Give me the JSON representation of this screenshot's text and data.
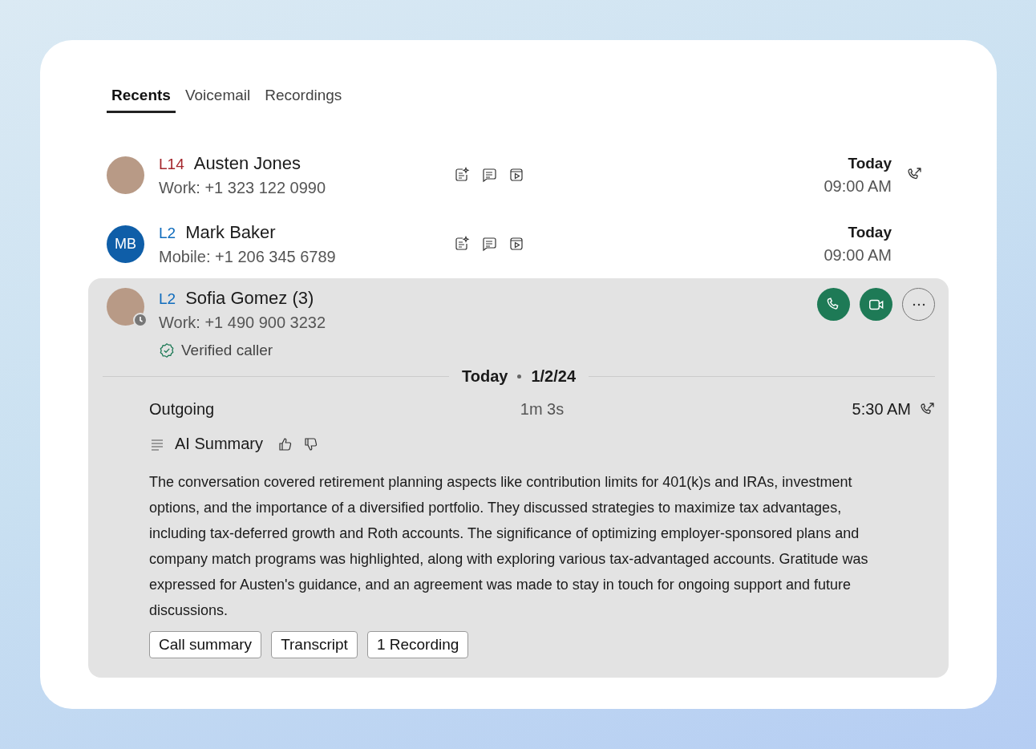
{
  "tabs": [
    {
      "label": "Recents",
      "selected": true
    },
    {
      "label": "Voicemail",
      "selected": false
    },
    {
      "label": "Recordings",
      "selected": false
    }
  ],
  "calls": [
    {
      "line": "L14",
      "color": "#a4262c",
      "name": "Austen Jones",
      "number": "Work: +1 323 122 0990",
      "avatar": {
        "kind": "photo"
      },
      "date": "Today",
      "time": "09:00 AM",
      "outgoing": true
    },
    {
      "line": "L2",
      "color": "#0f6cbd",
      "name": "Mark Baker",
      "number": "Mobile: +1 206 345 6789",
      "avatar": {
        "kind": "initials",
        "initials": "MB"
      },
      "date": "Today",
      "time": "09:00 AM",
      "outgoing": false
    }
  ],
  "expanded": {
    "line": "L2",
    "color": "#0f6cbd",
    "name": "Sofia Gomez (3)",
    "number": "Work: +1 490 900 3232",
    "avatar": {
      "kind": "photo",
      "away": true
    },
    "verified": "Verified caller",
    "date_day": "Today",
    "date_full": "1/2/24",
    "entry": {
      "direction": "Outgoing",
      "duration": "1m 3s",
      "time": "5:30 AM",
      "outgoing": true
    },
    "summary_title": "AI Summary",
    "summary": "The conversation covered retirement planning aspects like contribution limits for 401(k)s and IRAs, investment options, and the importance of a diversified portfolio. They discussed strategies to maximize tax advantages, including tax-deferred growth and Roth accounts. The significance of optimizing employer-sponsored plans and company match programs was highlighted, along with exploring various tax-advantaged accounts. Gratitude was expressed for Austen's guidance, and an agreement was made to stay in touch for ongoing support and future discussions.",
    "buttons": [
      "Call summary",
      "Transcript",
      "1 Recording"
    ]
  }
}
